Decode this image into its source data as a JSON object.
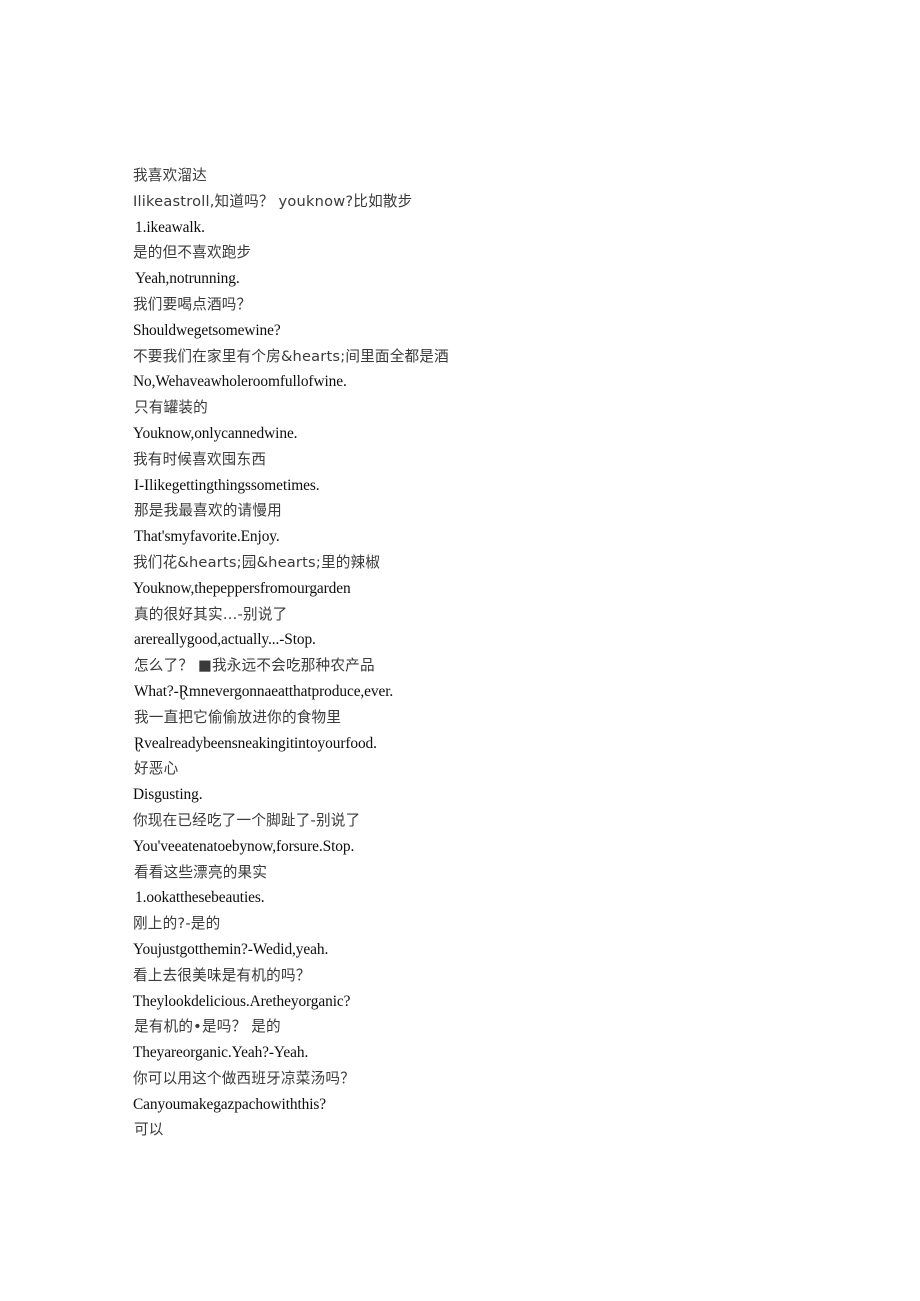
{
  "document": {
    "type": "subtitle-transcript",
    "background_color": "#ffffff",
    "text_color_chinese": "#3a3a3a",
    "text_color_english": "#0d0d0d",
    "lines": [
      {
        "lang": "cn",
        "text": "我喜欢溜达"
      },
      {
        "lang": "cn",
        "text": "Ilikeastroll,知道吗？ youknow?比如散步"
      },
      {
        "lang": "en",
        "text": "1.ikeawalk."
      },
      {
        "lang": "cn",
        "text": "是的但不喜欢跑步"
      },
      {
        "lang": "en",
        "text": "Yeah,notrunning."
      },
      {
        "lang": "cn",
        "text": "我们要喝点酒吗？"
      },
      {
        "lang": "en",
        "text": "Shouldwegetsomewine?"
      },
      {
        "lang": "cn",
        "text": "不要我们在家里有个房&hearts;间里面全都是酒"
      },
      {
        "lang": "en",
        "text": "No,Wehaveawholeroomfullofwine."
      },
      {
        "lang": "cn",
        "text": "只有罐装的"
      },
      {
        "lang": "en",
        "text": "Youknow,onlycannedwine."
      },
      {
        "lang": "cn",
        "text": "我有时候喜欢囤东西"
      },
      {
        "lang": "en",
        "text": "I-Ilikegettingthingssometimes."
      },
      {
        "lang": "cn",
        "text": "那是我最喜欢的请慢用"
      },
      {
        "lang": "en",
        "text": "That'smyfavorite.Enjoy."
      },
      {
        "lang": "cn",
        "text": "我们花&hearts;园&hearts;里的辣椒"
      },
      {
        "lang": "en",
        "text": "Youknow,thepeppersfromourgarden"
      },
      {
        "lang": "cn",
        "text": "真的很好其实…‐别说了"
      },
      {
        "lang": "en",
        "text": "arereallygood,actually...-Stop."
      },
      {
        "lang": "cn",
        "text": "怎么了？ ■我永远不会吃那种农产品"
      },
      {
        "lang": "en",
        "text": "What?-Ɽmnevergonnaeatthatproduce,ever."
      },
      {
        "lang": "cn",
        "text": "我一直把它偷偷放进你的食物里"
      },
      {
        "lang": "en",
        "text": "Ɽvealreadybeensneakingitintoyourfood."
      },
      {
        "lang": "cn",
        "text": "好恶心"
      },
      {
        "lang": "en",
        "text": "Disgusting."
      },
      {
        "lang": "cn",
        "text": "你现在已经吃了一个脚趾了‐别说了"
      },
      {
        "lang": "en",
        "text": "You'veeatenatoebynow,forsure.Stop."
      },
      {
        "lang": "cn",
        "text": "看看这些漂亮的果实"
      },
      {
        "lang": "en",
        "text": "1.ookatthesebeauties."
      },
      {
        "lang": "cn",
        "text": "刚上的?‐是的"
      },
      {
        "lang": "en",
        "text": "Youjustgotthemin?-Wedid,yeah."
      },
      {
        "lang": "cn",
        "text": "看上去很美味是有机的吗？"
      },
      {
        "lang": "en",
        "text": "Theylookdelicious.Aretheyorganic?"
      },
      {
        "lang": "cn",
        "text": "是有机的•是吗？ 是的"
      },
      {
        "lang": "en",
        "text": "Theyareorganic.Yeah?-Yeah."
      },
      {
        "lang": "cn",
        "text": "你可以用这个做西班牙凉菜汤吗？"
      },
      {
        "lang": "en",
        "text": "Canyoumakegazpachowiththis?"
      },
      {
        "lang": "cn",
        "text": "可以"
      }
    ]
  }
}
